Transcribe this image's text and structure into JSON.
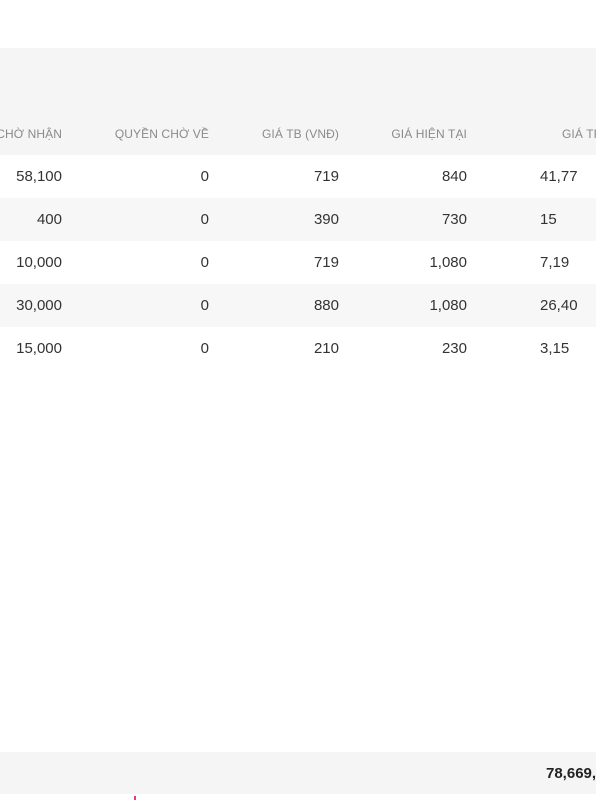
{
  "table": {
    "headers": [
      "CHỜ NHẬN",
      "QUYỀN CHỜ VỀ",
      "GIÁ TB (VNĐ)",
      "GIÁ HIỆN TẠI",
      "GIÁ TR"
    ],
    "rows": [
      [
        "58,100",
        "0",
        "719",
        "840",
        "41,77"
      ],
      [
        "400",
        "0",
        "390",
        "730",
        "15"
      ],
      [
        "10,000",
        "0",
        "719",
        "1,080",
        "7,19"
      ],
      [
        "30,000",
        "0",
        "880",
        "1,080",
        "26,40"
      ],
      [
        "15,000",
        "0",
        "210",
        "230",
        "3,15"
      ]
    ]
  },
  "footer": {
    "total": "78,669,"
  },
  "colors": {
    "header_bg": "#f5f5f5",
    "row_alt_bg": "#f7f7f7",
    "accent_pink": "#e63c6e"
  }
}
